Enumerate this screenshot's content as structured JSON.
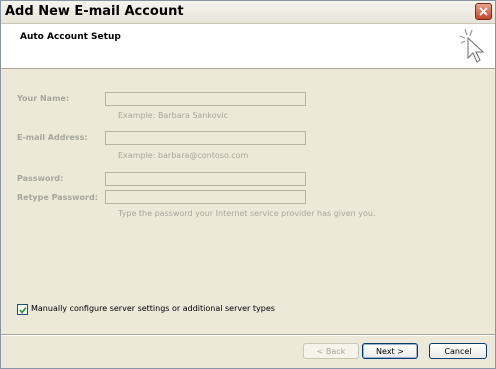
{
  "window": {
    "title": "Add New E-mail Account"
  },
  "header": {
    "title": "Auto Account Setup"
  },
  "form": {
    "your_name": {
      "label": "Your Name:",
      "value": "",
      "hint": "Example: Barbara Sankovic"
    },
    "email": {
      "label": "E-mail Address:",
      "value": "",
      "hint": "Example: barbara@contoso.com"
    },
    "password": {
      "label": "Password:",
      "value": ""
    },
    "retype_password": {
      "label": "Retype Password:",
      "value": "",
      "hint": "Type the password your Internet service provider has given you."
    }
  },
  "manual_config": {
    "label": "Manually configure server settings or additional server types",
    "checked": true
  },
  "buttons": {
    "back": "< Back",
    "next": "Next >",
    "cancel": "Cancel"
  }
}
